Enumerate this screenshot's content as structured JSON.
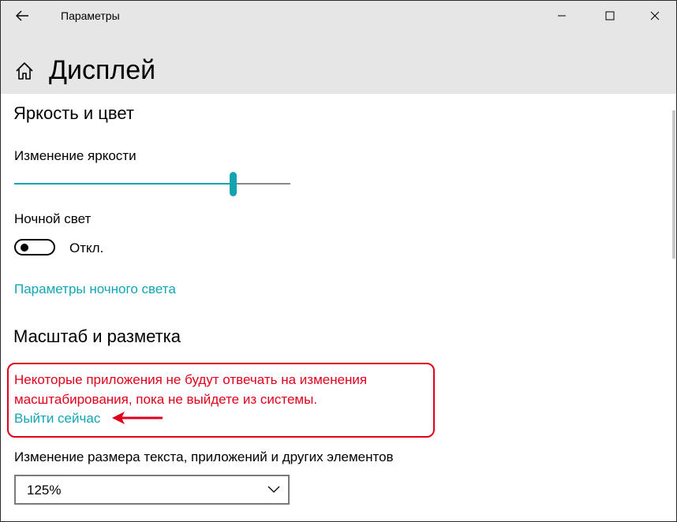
{
  "window": {
    "title": "Параметры",
    "controls": [
      "minimize",
      "maximize",
      "close"
    ]
  },
  "page": {
    "title": "Дисплей"
  },
  "brightness_section": {
    "heading": "Яркость и цвет",
    "brightness_label": "Изменение яркости",
    "brightness_level_percent": 79,
    "night_light_label": "Ночной свет",
    "night_light_state": "Откл.",
    "night_light_on": false,
    "night_light_settings_link": "Параметры ночного света"
  },
  "scale_section": {
    "heading": "Масштаб и разметка",
    "warning_text": "Некоторые приложения не будут отвечать на изменения масштабирования, пока не выйдете из системы.",
    "sign_out_link": "Выйти сейчас",
    "scale_label": "Изменение размера текста, приложений и других элементов",
    "scale_value": "125%"
  },
  "colors": {
    "accent": "#12a5b3",
    "warning": "#e0001b",
    "chrome": "#e6e6e6"
  },
  "icons": [
    "back-arrow-icon",
    "minimize-icon",
    "maximize-icon",
    "close-icon",
    "home-icon",
    "chevron-down-icon",
    "annotation-arrow-icon"
  ]
}
